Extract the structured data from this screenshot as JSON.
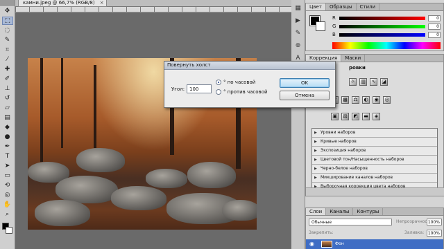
{
  "document": {
    "tab_title": "камни.jpeg @ 66,7% (RGB/8)",
    "tab_close": "×"
  },
  "color_panel": {
    "tabs": [
      "Цвет",
      "Образцы",
      "Стили"
    ],
    "channels": [
      {
        "label": "R",
        "value": "0",
        "gradient_from": "#000000",
        "gradient_to": "#ff0000"
      },
      {
        "label": "G",
        "value": "0",
        "gradient_from": "#000000",
        "gradient_to": "#00ff00"
      },
      {
        "label": "B",
        "value": "0",
        "gradient_from": "#000000",
        "gradient_to": "#0000ff"
      }
    ]
  },
  "adjustments_panel": {
    "tabs": [
      "Коррекция",
      "Маски"
    ],
    "title": "ровки",
    "presets": [
      "Уровни наборов",
      "Кривые наборов",
      "Экспозиция наборов",
      "Цветовой тон/Насыщенность наборов",
      "Черно-белое наборов",
      "Микширование каналов наборов",
      "Выборочная коррекция цвета наборов"
    ]
  },
  "layers_panel": {
    "tabs": [
      "Слои",
      "Каналы",
      "Контуры"
    ],
    "blend_mode": "Обычные",
    "opacity_label": "Непрозрачность:",
    "opacity_value": "100%",
    "lock_label": "Закрепить:",
    "fill_label": "Заливка:",
    "fill_value": "100%",
    "layer_name": "Фон"
  },
  "dialog": {
    "title": "Повернуть холст",
    "angle_label": "Угол:",
    "angle_value": "100",
    "clockwise_label": "° по часовой",
    "counterclockwise_label": "° против часовой",
    "ok_label": "OK",
    "cancel_label": "Отмена"
  },
  "colors": {
    "accent": "#3f6dc4",
    "ok_button": "#b6dcf4",
    "foreground": "#000000",
    "background": "#ffffff"
  }
}
